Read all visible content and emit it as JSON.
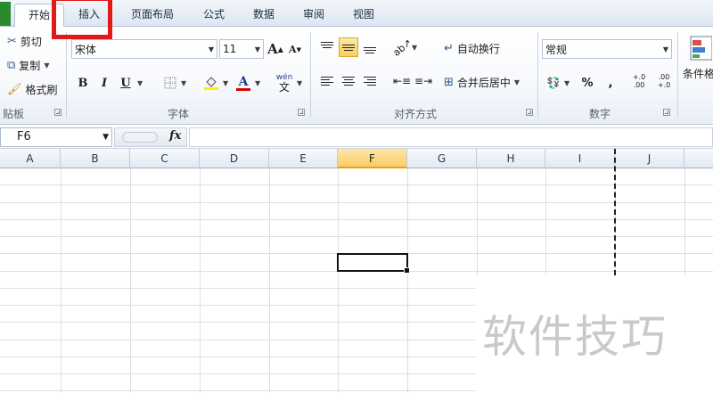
{
  "tabs": [
    {
      "label": "开始",
      "active": true
    },
    {
      "label": "插入",
      "active": false
    },
    {
      "label": "页面布局",
      "active": false
    },
    {
      "label": "公式",
      "active": false
    },
    {
      "label": "数据",
      "active": false
    },
    {
      "label": "审阅",
      "active": false
    },
    {
      "label": "视图",
      "active": false
    }
  ],
  "clipboard": {
    "cut": "剪切",
    "copy": "复制",
    "format_painter": "格式刷",
    "group_label": "贴板"
  },
  "font": {
    "name": "宋体",
    "size": "11",
    "bold": "B",
    "italic": "I",
    "underline": "U",
    "font_color": "A",
    "grow": "A",
    "shrink": "A",
    "phonetic": "wén",
    "group_label": "字体"
  },
  "alignment": {
    "wrap_text": "自动换行",
    "merge_center": "合并后居中",
    "group_label": "对齐方式"
  },
  "number": {
    "format": "常规",
    "percent": "%",
    "comma": ",",
    "increase_decimal": "+.0 .00",
    "decrease_decimal": ".00 +.0",
    "group_label": "数字"
  },
  "styles": {
    "conditional_format": "条件格"
  },
  "formula_bar": {
    "name_box": "F6",
    "fx": "fx",
    "value": ""
  },
  "columns": [
    "A",
    "B",
    "C",
    "D",
    "E",
    "F",
    "G",
    "H",
    "I",
    "J"
  ],
  "selected_column": "F",
  "watermark": "软件技巧",
  "colors": {
    "highlight_box": "#e11919",
    "selected_header": "#f8cd67",
    "file_tab": "#2a8a2e"
  }
}
